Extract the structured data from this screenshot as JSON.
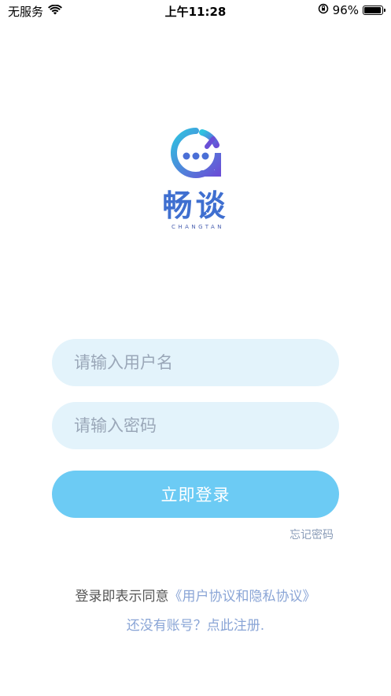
{
  "status_bar": {
    "carrier": "无服务",
    "time": "上午11:28",
    "battery_percent": "96%",
    "battery_level": 0.96
  },
  "logo": {
    "wordmark": "畅谈",
    "subtitle": "CHANGTAN",
    "colors": {
      "gradient_start": "#2fc3e0",
      "gradient_end": "#6a4fd6",
      "text": "#3f6fd0"
    }
  },
  "login_form": {
    "username_placeholder": "请输入用户名",
    "username_value": "",
    "password_placeholder": "请输入密码",
    "password_value": "",
    "login_button": "立即登录",
    "forgot_password": "忘记密码"
  },
  "footer": {
    "agree_prefix": "登录即表示同意",
    "agreement_link": "《用户协议和隐私协议》",
    "register_prompt": "还没有账号？点此注册."
  },
  "colors": {
    "input_bg": "#e3f3fb",
    "button_bg": "#6ccbf4",
    "link": "#8aa5d6"
  }
}
